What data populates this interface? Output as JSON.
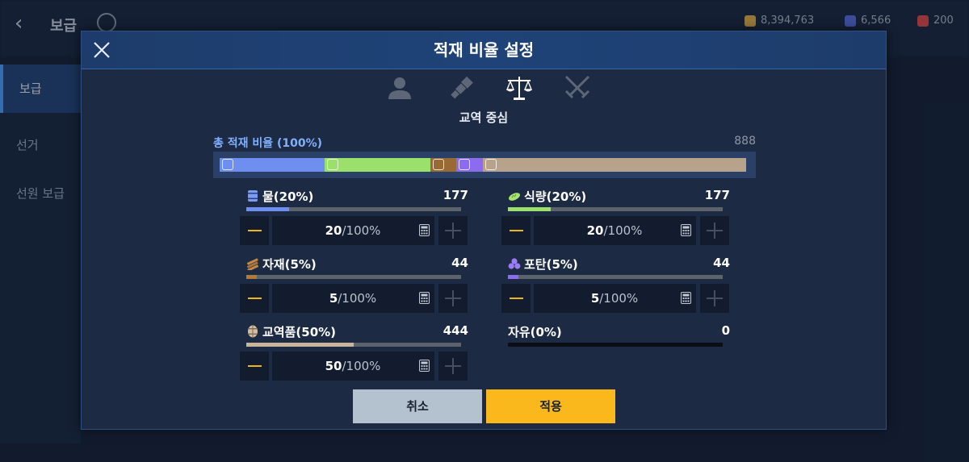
{
  "background": {
    "title": "보급",
    "resources": [
      "8,394,763",
      "6,566",
      "200"
    ],
    "tabs": [
      "보급",
      "선거",
      "선원 보급"
    ]
  },
  "dialog": {
    "title": "적재 비율 설정",
    "modes": [
      {
        "icon": "person-icon",
        "active": false
      },
      {
        "icon": "spyglass-icon",
        "active": false
      },
      {
        "icon": "scales-icon",
        "active": true
      },
      {
        "icon": "crossed-swords-icon",
        "active": false
      }
    ],
    "mode_label": "교역 중심",
    "total": {
      "label": "총 적재 비율 (100%)",
      "value": "888",
      "segments": [
        {
          "name": "물",
          "percent": 20,
          "color": "#6e8ff0",
          "icon": "water-barrel-icon"
        },
        {
          "name": "식량",
          "percent": 20,
          "color": "#9be06b",
          "icon": "bread-icon"
        },
        {
          "name": "자재",
          "percent": 5,
          "color": "#9a6a35",
          "icon": "lumber-icon"
        },
        {
          "name": "포탄",
          "percent": 5,
          "color": "#8b6cf0",
          "icon": "cannonball-icon"
        },
        {
          "name": "교역품",
          "percent": 50,
          "color": "#b7a38c",
          "icon": "trade-barrel-icon"
        }
      ]
    },
    "resources": [
      {
        "key": "water",
        "name": "물(20%)",
        "count": "177",
        "value": "20",
        "denominator": "/100%",
        "fill": 0.2,
        "color": "#6e8ff0"
      },
      {
        "key": "food",
        "name": "식량(20%)",
        "count": "177",
        "value": "20",
        "denominator": "/100%",
        "fill": 0.2,
        "color": "#9be06b"
      },
      {
        "key": "material",
        "name": "자재(5%)",
        "count": "44",
        "value": "5",
        "denominator": "/100%",
        "fill": 0.05,
        "color": "#b07a3a"
      },
      {
        "key": "cannonball",
        "name": "포탄(5%)",
        "count": "44",
        "value": "5",
        "denominator": "/100%",
        "fill": 0.05,
        "color": "#8b6cf0"
      },
      {
        "key": "trade",
        "name": "교역품(50%)",
        "count": "444",
        "value": "50",
        "denominator": "/100%",
        "fill": 0.5,
        "color": "#c9b59c"
      },
      {
        "key": "free",
        "name": "자유(0%)",
        "count": "0",
        "fill": 0
      }
    ],
    "cancel_label": "취소",
    "apply_label": "적용"
  }
}
